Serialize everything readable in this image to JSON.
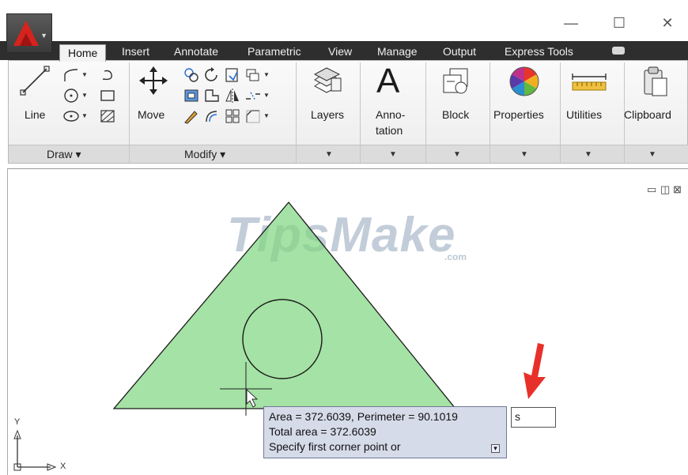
{
  "titlebar": {
    "minimize": "—",
    "maximize": "☐",
    "close": "✕"
  },
  "tabs": [
    "Home",
    "Insert",
    "Annotate",
    "Parametric",
    "View",
    "Manage",
    "Output",
    "Express Tools"
  ],
  "ribbon": {
    "draw": {
      "line_label": "Line",
      "panel_title": "Draw ▾"
    },
    "modify": {
      "move_label": "Move",
      "panel_title": "Modify ▾"
    },
    "layers_label": "Layers",
    "annotation_label_1": "Anno-",
    "annotation_label_2": "tation",
    "block_label": "Block",
    "properties_label": "Properties",
    "utilities_label": "Utilities",
    "clipboard_label": "Clipboard"
  },
  "watermark": {
    "text": "TipsMake",
    "suffix": ".com"
  },
  "tooltip": {
    "line1": "Area = 372.6039, Perimeter = 90.1019",
    "line2": "Total area = 372.6039",
    "line3": "Specify first corner point or"
  },
  "command_input": {
    "value": "s"
  },
  "ucs": {
    "y_label": "Y",
    "x_label": "X"
  },
  "colors": {
    "fill": "#a6e3a6",
    "tooltip_bg": "#d6dbe9",
    "arrow": "#e8302a",
    "tabbar": "#2e2e2e"
  }
}
